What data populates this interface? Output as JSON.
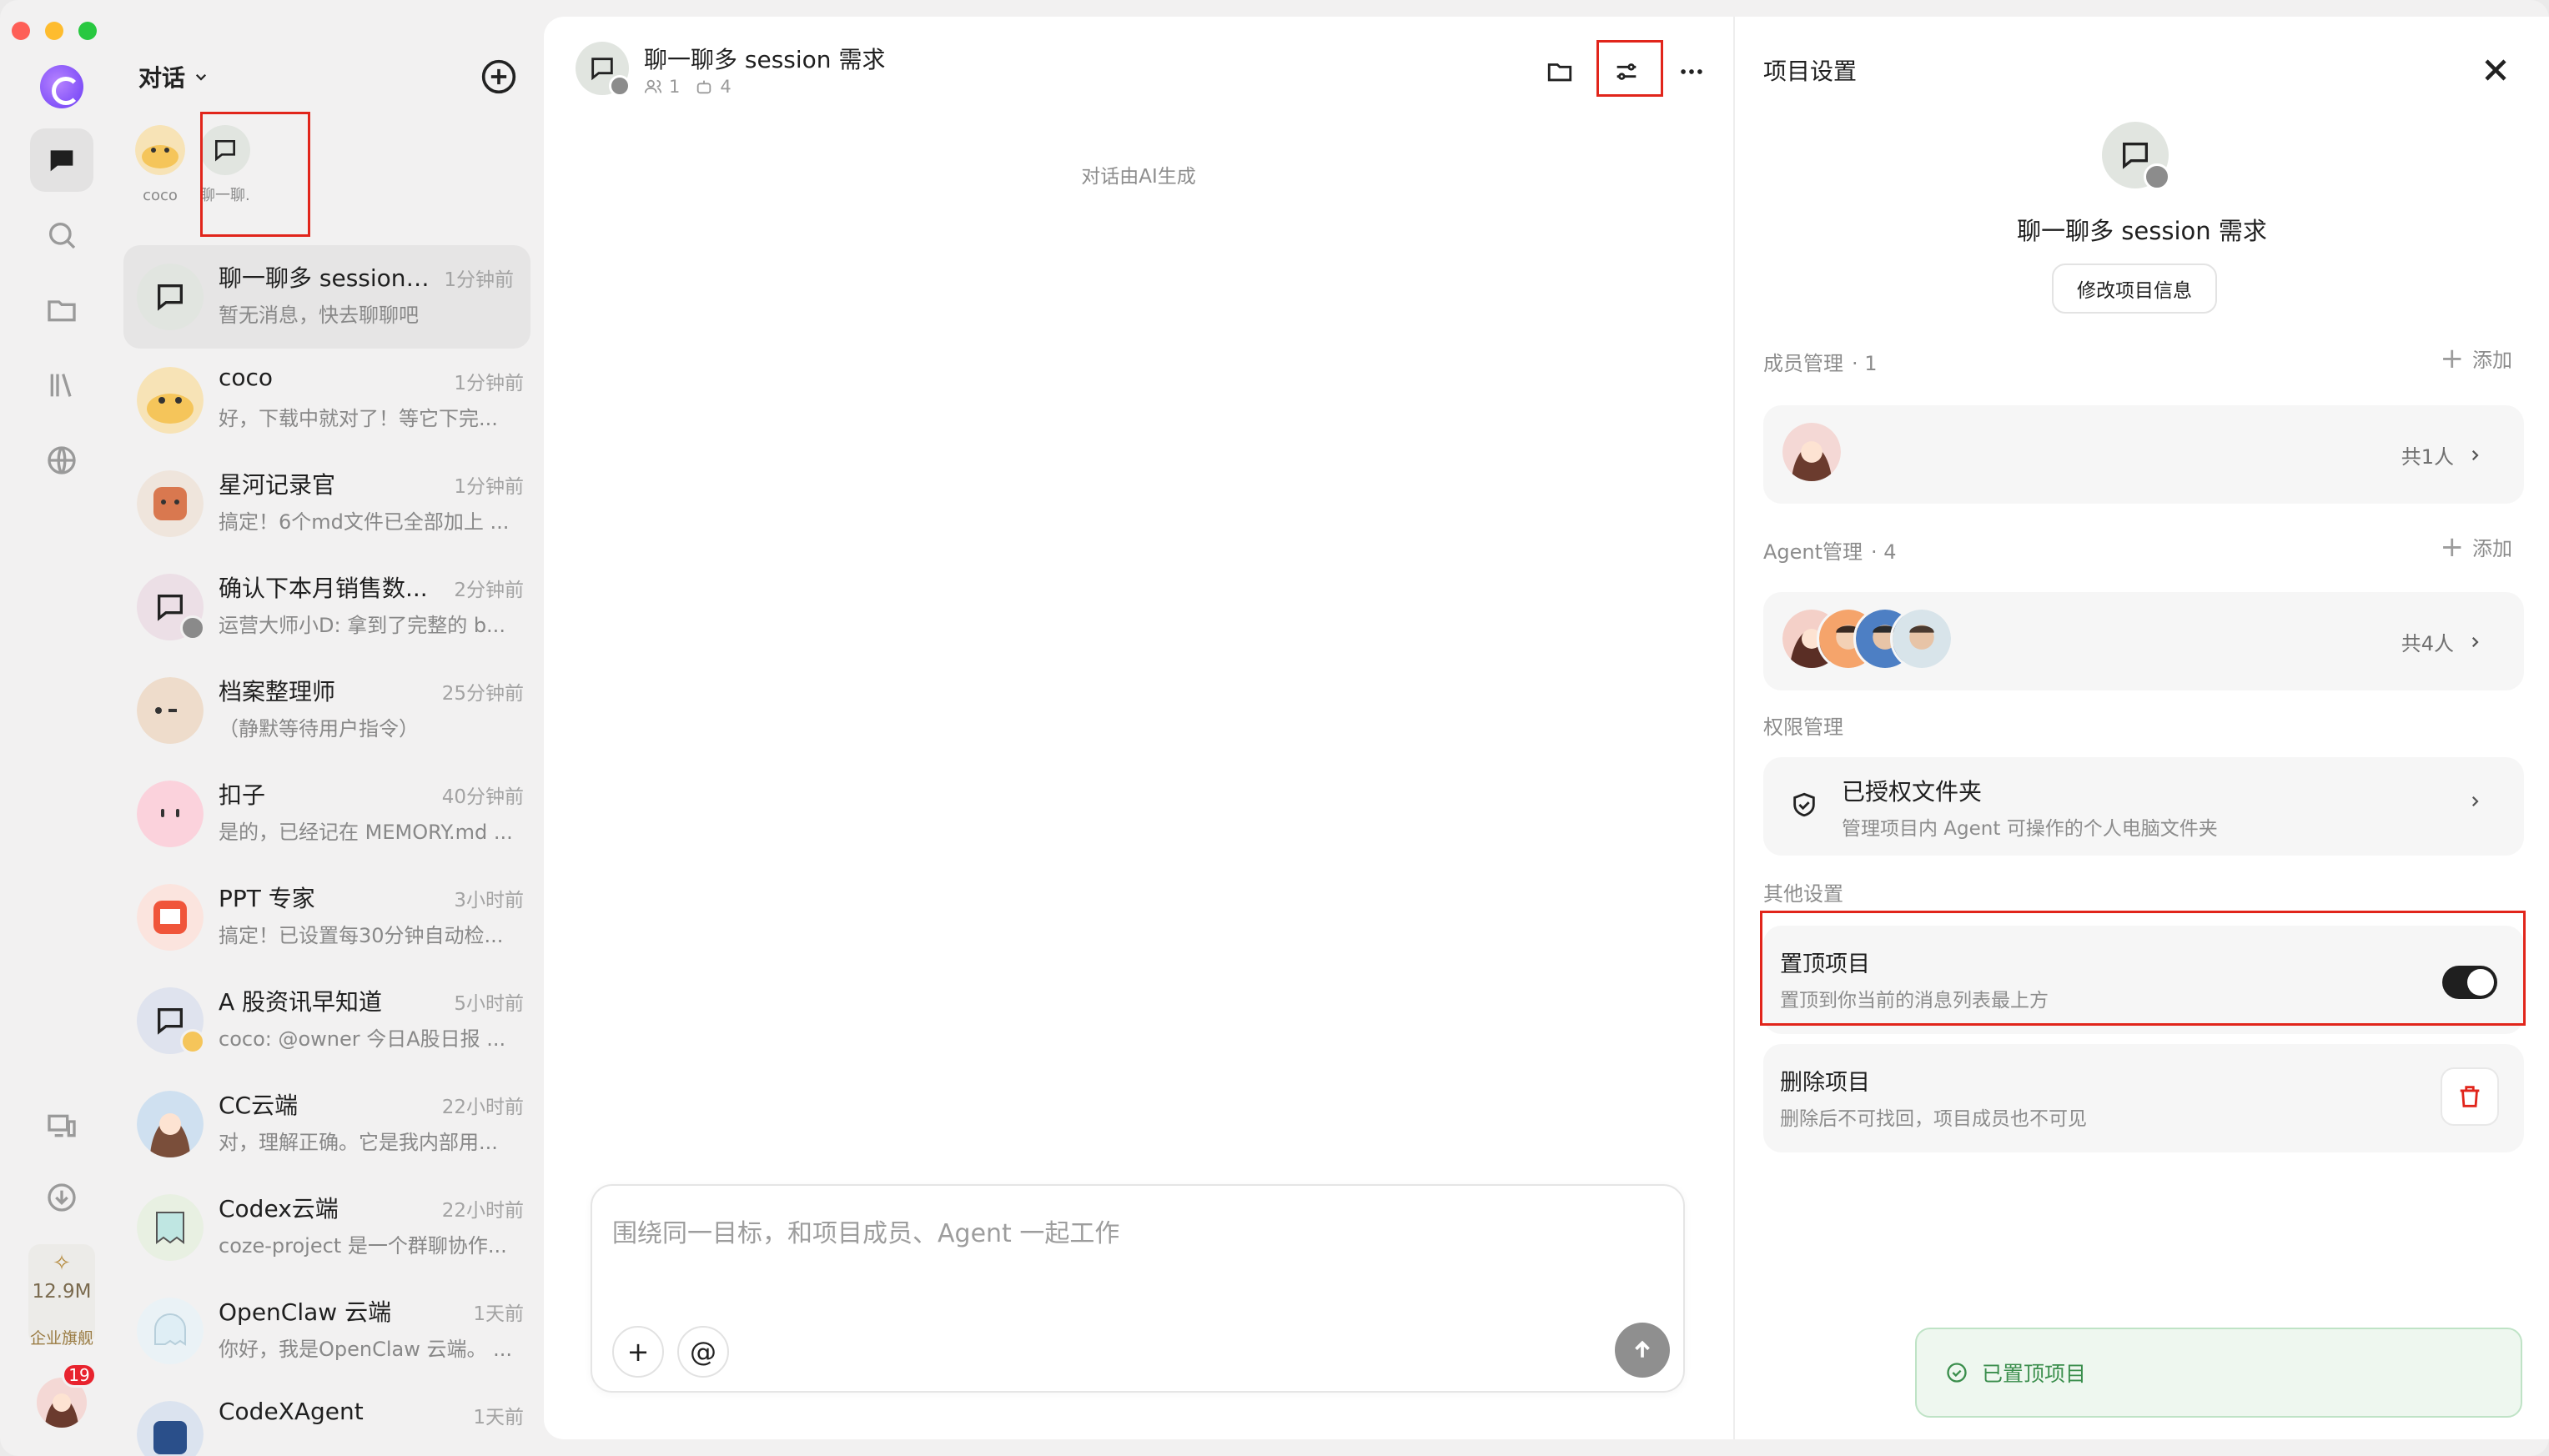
{
  "sidebar": {
    "usage_value": "12.9M",
    "usage_label": "企业旗舰",
    "unread_badge": "19"
  },
  "list": {
    "header": "对话",
    "pinned": [
      {
        "label": "coco"
      },
      {
        "label": "聊一聊..."
      }
    ],
    "conversations": [
      {
        "name": "聊一聊多 session ...",
        "time": "1分钟前",
        "preview": "暂无消息，快去聊聊吧"
      },
      {
        "name": "coco",
        "time": "1分钟前",
        "preview": "好，下载中就对了！等它下完..."
      },
      {
        "name": "星河记录官",
        "time": "1分钟前",
        "preview": "搞定！6个md文件已全部加上 ..."
      },
      {
        "name": "确认下本月销售数...",
        "time": "2分钟前",
        "preview": "运营大师小D: 拿到了完整的 b..."
      },
      {
        "name": "档案整理师",
        "time": "25分钟前",
        "preview": "（静默等待用户指令）"
      },
      {
        "name": "扣子",
        "time": "40分钟前",
        "preview": "是的，已经记在 MEMORY.md ..."
      },
      {
        "name": "PPT 专家",
        "time": "3小时前",
        "preview": "搞定！已设置每30分钟自动检..."
      },
      {
        "name": "A 股资讯早知道",
        "time": "5小时前",
        "preview": "coco: @owner 今日A股日报 ..."
      },
      {
        "name": "CC云端",
        "time": "22小时前",
        "preview": "对，理解正确。它是我内部用..."
      },
      {
        "name": "Codex云端",
        "time": "22小时前",
        "preview": "coze-project 是一个群聊协作..."
      },
      {
        "name": "OpenClaw 云端",
        "time": "1天前",
        "preview": "你好，我是OpenClaw 云端。 ..."
      },
      {
        "name": "CodeXAgent",
        "time": "1天前",
        "preview": ""
      }
    ]
  },
  "chat": {
    "title": "聊一聊多 session 需求",
    "member_count": "1",
    "agent_count": "4",
    "note": "对话由AI生成",
    "composer_placeholder": "围绕同一目标，和项目成员、Agent 一起工作",
    "plus_label": "+",
    "mention_label": "@"
  },
  "settings": {
    "title": "项目设置",
    "project_name": "聊一聊多 session 需求",
    "edit_button": "修改项目信息",
    "members_label": "成员管理",
    "members_count": "· 1",
    "add_label": "添加",
    "members_total": "共1人",
    "agents_label": "Agent管理",
    "agents_count": "· 4",
    "agents_total": "共4人",
    "permissions_label": "权限管理",
    "authorized_title": "已授权文件夹",
    "authorized_sub": "管理项目内 Agent 可操作的个人电脑文件夹",
    "other_label": "其他设置",
    "pin_title": "置顶项目",
    "pin_sub": "置顶到你当前的消息列表最上方",
    "pin_enabled": true,
    "delete_title": "删除项目",
    "delete_sub": "删除后不可找回，项目成员也不可见",
    "toast": "已置顶项目"
  },
  "colors": {
    "highlight": "#e1251b",
    "toast_text": "#3a8e4c",
    "danger": "#e1251b",
    "badge": "#e8232e"
  }
}
